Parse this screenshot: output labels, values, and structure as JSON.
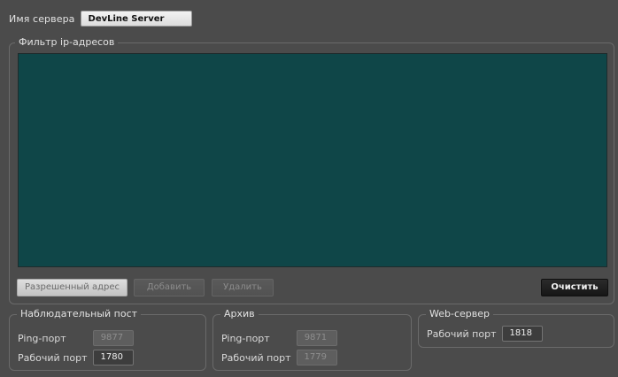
{
  "server": {
    "label": "Имя сервера",
    "value": "DevLine Server"
  },
  "ip_filter": {
    "legend": "Фильтр ip-адресов",
    "list_items": [],
    "buttons": {
      "allowed": "Разрешенный адрес",
      "add": "Добавить",
      "delete": "Удалить",
      "clear": "Очистить"
    }
  },
  "observation_post": {
    "legend": "Наблюдательный пост",
    "ping_label": "Ping-порт",
    "ping_value": "9877",
    "work_label": "Рабочий порт",
    "work_value": "1780"
  },
  "archive": {
    "legend": "Архив",
    "ping_label": "Ping-порт",
    "ping_value": "9871",
    "work_label": "Рабочий порт",
    "work_value": "1779"
  },
  "web_server": {
    "legend": "Web-сервер",
    "work_label": "Рабочий порт",
    "work_value": "1818"
  },
  "colors": {
    "background": "#4b4b4b",
    "ip_list_background": "#0f4648",
    "clear_button": "#1c1c1c"
  }
}
